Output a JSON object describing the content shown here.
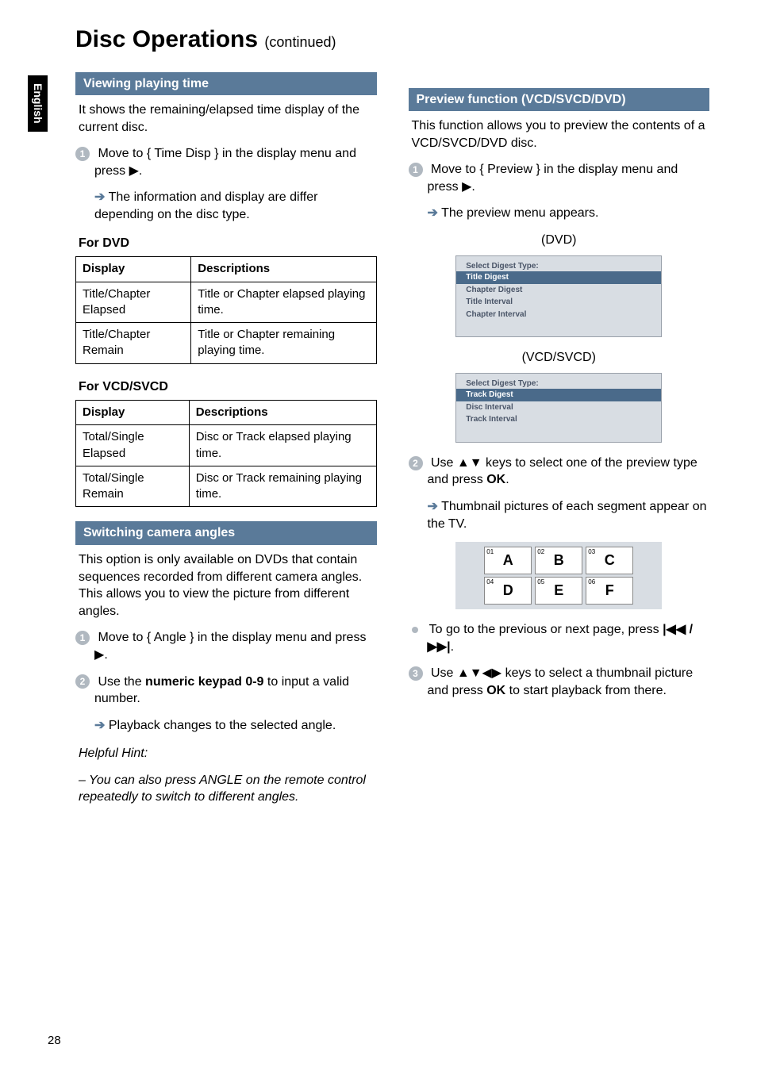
{
  "lang_tab": "English",
  "title_main": "Disc Operations",
  "title_cont": "(continued)",
  "left": {
    "sec1_header": "Viewing playing time",
    "sec1_p1": "It shows the remaining/elapsed time display of the current disc.",
    "sec1_step1a": "Move to { Time Disp } in the display menu and press ",
    "sec1_step1b": ".",
    "sec1_res1": "The information and display are differ depending on the disc type.",
    "dvd_head": "For DVD",
    "th1": "Display",
    "th2": "Descriptions",
    "dvd_r1c1": "Title/Chapter Elapsed",
    "dvd_r1c2": "Title or Chapter elapsed playing time.",
    "dvd_r2c1": "Title/Chapter Remain",
    "dvd_r2c2": "Title or Chapter remaining playing time.",
    "vcd_head": "For VCD/SVCD",
    "vcd_r1c1": "Total/Single Elapsed",
    "vcd_r1c2": "Disc or Track elapsed playing time.",
    "vcd_r2c1": "Total/Single Remain",
    "vcd_r2c2": "Disc or Track remaining playing time.",
    "sec2_header": "Switching camera angles",
    "sec2_p1": "This option is only available on DVDs that contain sequences recorded from different camera angles. This allows you to view the picture from different angles.",
    "sec2_step1a": "Move to { Angle } in the display menu and press ",
    "sec2_step1b": ".",
    "sec2_step2a": "Use the ",
    "sec2_step2b": "numeric keypad 0-9",
    "sec2_step2c": " to input a valid number.",
    "sec2_res": "Playback changes to the selected angle.",
    "hint_head": "Helpful Hint:",
    "hint_body": "–   You can also press ANGLE on the remote control repeatedly to switch to different angles."
  },
  "right": {
    "sec_header": "Preview function (VCD/SVCD/DVD)",
    "p1": "This function allows you to preview the contents of a VCD/SVCD/DVD disc.",
    "step1a": "Move to { Preview } in the display menu and press ",
    "step1b": ".",
    "res1": "The preview menu appears.",
    "dvd_label": "(DVD)",
    "menu1_title": "Select Digest Type:",
    "menu1_items": [
      "Title  Digest",
      "Chapter  Digest",
      "Title Interval",
      "Chapter Interval"
    ],
    "vcd_label": "(VCD/SVCD)",
    "menu2_title": "Select Digest Type:",
    "menu2_items": [
      "Track  Digest",
      "Disc Interval",
      "Track Interval"
    ],
    "step2a": "Use ",
    "step2b": " keys to select one of the preview type and press ",
    "step2ok": "OK",
    "step2c": ".",
    "res2": "Thumbnail pictures of each segment appear on the TV.",
    "thumbs": [
      {
        "n": "01",
        "l": "A"
      },
      {
        "n": "02",
        "l": "B"
      },
      {
        "n": "03",
        "l": "C"
      },
      {
        "n": "04",
        "l": "D"
      },
      {
        "n": "05",
        "l": "E"
      },
      {
        "n": "06",
        "l": "F"
      }
    ],
    "bullet1a": "To go to the previous or next page, press ",
    "bullet1b": ".",
    "step3a": "Use ",
    "step3b": " keys to select a thumbnail picture and press ",
    "step3ok": "OK",
    "step3c": " to start playback from there."
  },
  "pagenum": "28"
}
